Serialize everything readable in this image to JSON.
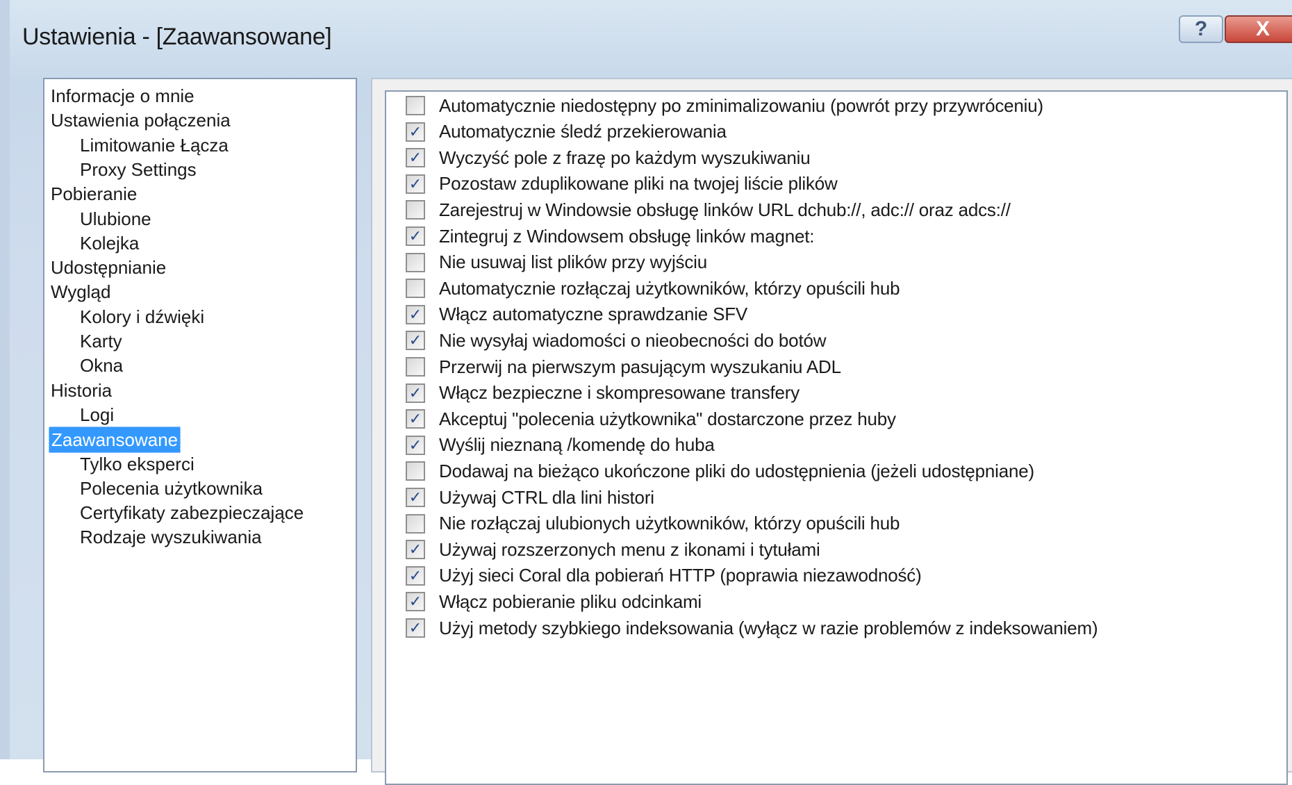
{
  "window": {
    "title": "Ustawienia - [Zaawansowane]",
    "help_label": "?",
    "close_label": "X"
  },
  "nav": [
    {
      "label": "Informacje o mnie",
      "level": 0,
      "selected": false
    },
    {
      "label": "Ustawienia połączenia",
      "level": 0,
      "selected": false
    },
    {
      "label": "Limitowanie Łącza",
      "level": 1,
      "selected": false
    },
    {
      "label": "Proxy Settings",
      "level": 1,
      "selected": false
    },
    {
      "label": "Pobieranie",
      "level": 0,
      "selected": false
    },
    {
      "label": "Ulubione",
      "level": 1,
      "selected": false
    },
    {
      "label": "Kolejka",
      "level": 1,
      "selected": false
    },
    {
      "label": "Udostępnianie",
      "level": 0,
      "selected": false
    },
    {
      "label": "Wygląd",
      "level": 0,
      "selected": false
    },
    {
      "label": "Kolory i dźwięki",
      "level": 1,
      "selected": false
    },
    {
      "label": "Karty",
      "level": 1,
      "selected": false
    },
    {
      "label": "Okna",
      "level": 1,
      "selected": false
    },
    {
      "label": "Historia",
      "level": 0,
      "selected": false
    },
    {
      "label": "Logi",
      "level": 1,
      "selected": false
    },
    {
      "label": "Zaawansowane",
      "level": 0,
      "selected": true
    },
    {
      "label": "Tylko eksperci",
      "level": 1,
      "selected": false
    },
    {
      "label": "Polecenia użytkownika",
      "level": 1,
      "selected": false
    },
    {
      "label": "Certyfikaty zabezpieczające",
      "level": 1,
      "selected": false
    },
    {
      "label": "Rodzaje wyszukiwania",
      "level": 1,
      "selected": false
    }
  ],
  "options": [
    {
      "label": "Automatycznie niedostępny po zminimalizowaniu (powrót przy przywróceniu)",
      "checked": false
    },
    {
      "label": "Automatycznie śledź przekierowania",
      "checked": true
    },
    {
      "label": "Wyczyść pole z frazę po każdym wyszukiwaniu",
      "checked": true
    },
    {
      "label": "Pozostaw zduplikowane pliki na twojej liście plików",
      "checked": true
    },
    {
      "label": "Zarejestruj w Windowsie obsługę linków URL dchub://, adc:// oraz adcs://",
      "checked": false
    },
    {
      "label": "Zintegruj z Windowsem obsługę linków magnet:",
      "checked": true
    },
    {
      "label": "Nie usuwaj list plików przy wyjściu",
      "checked": false
    },
    {
      "label": "Automatycznie rozłączaj użytkowników, którzy opuścili hub",
      "checked": false
    },
    {
      "label": "Włącz automatyczne sprawdzanie SFV",
      "checked": true
    },
    {
      "label": "Nie wysyłaj wiadomości o nieobecności do botów",
      "checked": true
    },
    {
      "label": "Przerwij na pierwszym pasującym wyszukaniu ADL",
      "checked": false
    },
    {
      "label": "Włącz bezpieczne i skompresowane transfery",
      "checked": true
    },
    {
      "label": "Akceptuj \"polecenia użytkownika\" dostarczone przez huby",
      "checked": true
    },
    {
      "label": "Wyślij nieznaną /komendę do huba",
      "checked": true
    },
    {
      "label": "Dodawaj na bieżąco ukończone pliki do udostępnienia (jeżeli udostępniane)",
      "checked": false
    },
    {
      "label": "Używaj CTRL dla lini histori",
      "checked": true
    },
    {
      "label": "Nie rozłączaj ulubionych użytkowników, którzy opuścili hub",
      "checked": false
    },
    {
      "label": "Używaj rozszerzonych menu z ikonami i tytułami",
      "checked": true
    },
    {
      "label": "Użyj sieci Coral dla pobierań HTTP (poprawia niezawodność)",
      "checked": true
    },
    {
      "label": "Włącz pobieranie pliku odcinkami",
      "checked": true
    },
    {
      "label": "Użyj metody szybkiego indeksowania (wyłącz w razie problemów z indeksowaniem)",
      "checked": true
    }
  ],
  "colors": {
    "selection": "#3399ff",
    "check_mark": "#2a4a8a"
  }
}
